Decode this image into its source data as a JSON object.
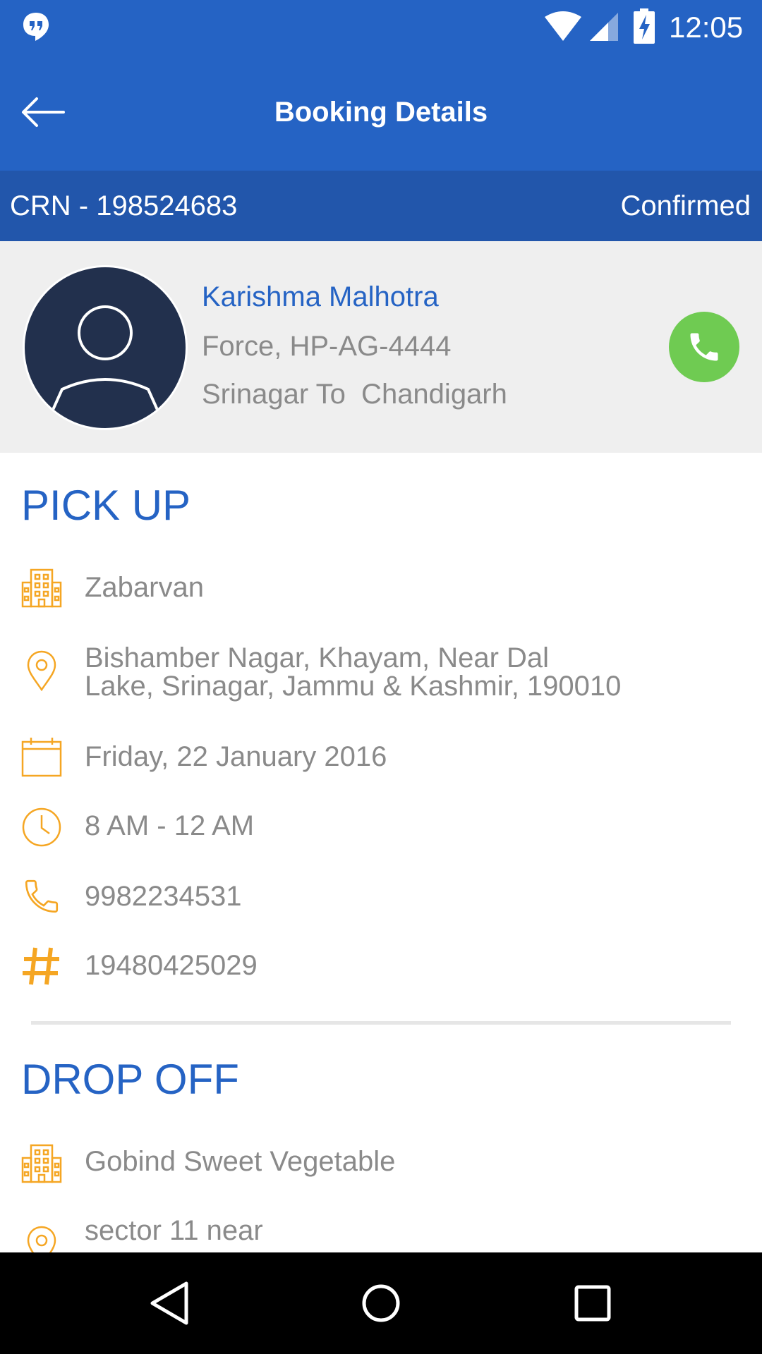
{
  "status_bar": {
    "time": "12:05",
    "icons": [
      "hangouts-icon",
      "wifi-icon",
      "signal-icon",
      "battery-charging-icon"
    ]
  },
  "app_bar": {
    "title": "Booking Details",
    "back_icon": "arrow-left-icon"
  },
  "booking": {
    "crn": "CRN - 198524683",
    "status": "Confirmed"
  },
  "driver": {
    "name": "Karishma Malhotra",
    "vehicle": "Force, HP-AG-4444",
    "route": "Srinagar To  Chandigarh",
    "call_icon": "phone-icon"
  },
  "pickup": {
    "title": "PICK UP",
    "place": "Zabarvan",
    "address_line1": "Bishamber Nagar, Khayam, Near Dal",
    "address_line2": "Lake, Srinagar, Jammu & Kashmir, 190010",
    "date": "Friday, 22 January 2016",
    "time": "8 AM - 12 AM",
    "phone": "9982234531",
    "ref": "19480425029"
  },
  "dropoff": {
    "title": "DROP OFF",
    "place": "Gobind Sweet Vegetable",
    "address_line1": "sector 11 near"
  },
  "colors": {
    "primary": "#2563c4",
    "crn_bar": "#2256ab",
    "accent_orange": "#f5a623",
    "call_green": "#6fcb52",
    "text_grey": "#8a8a8a"
  },
  "nav_bar": {
    "icons": [
      "back-triangle-icon",
      "home-circle-icon",
      "recents-square-icon"
    ]
  }
}
